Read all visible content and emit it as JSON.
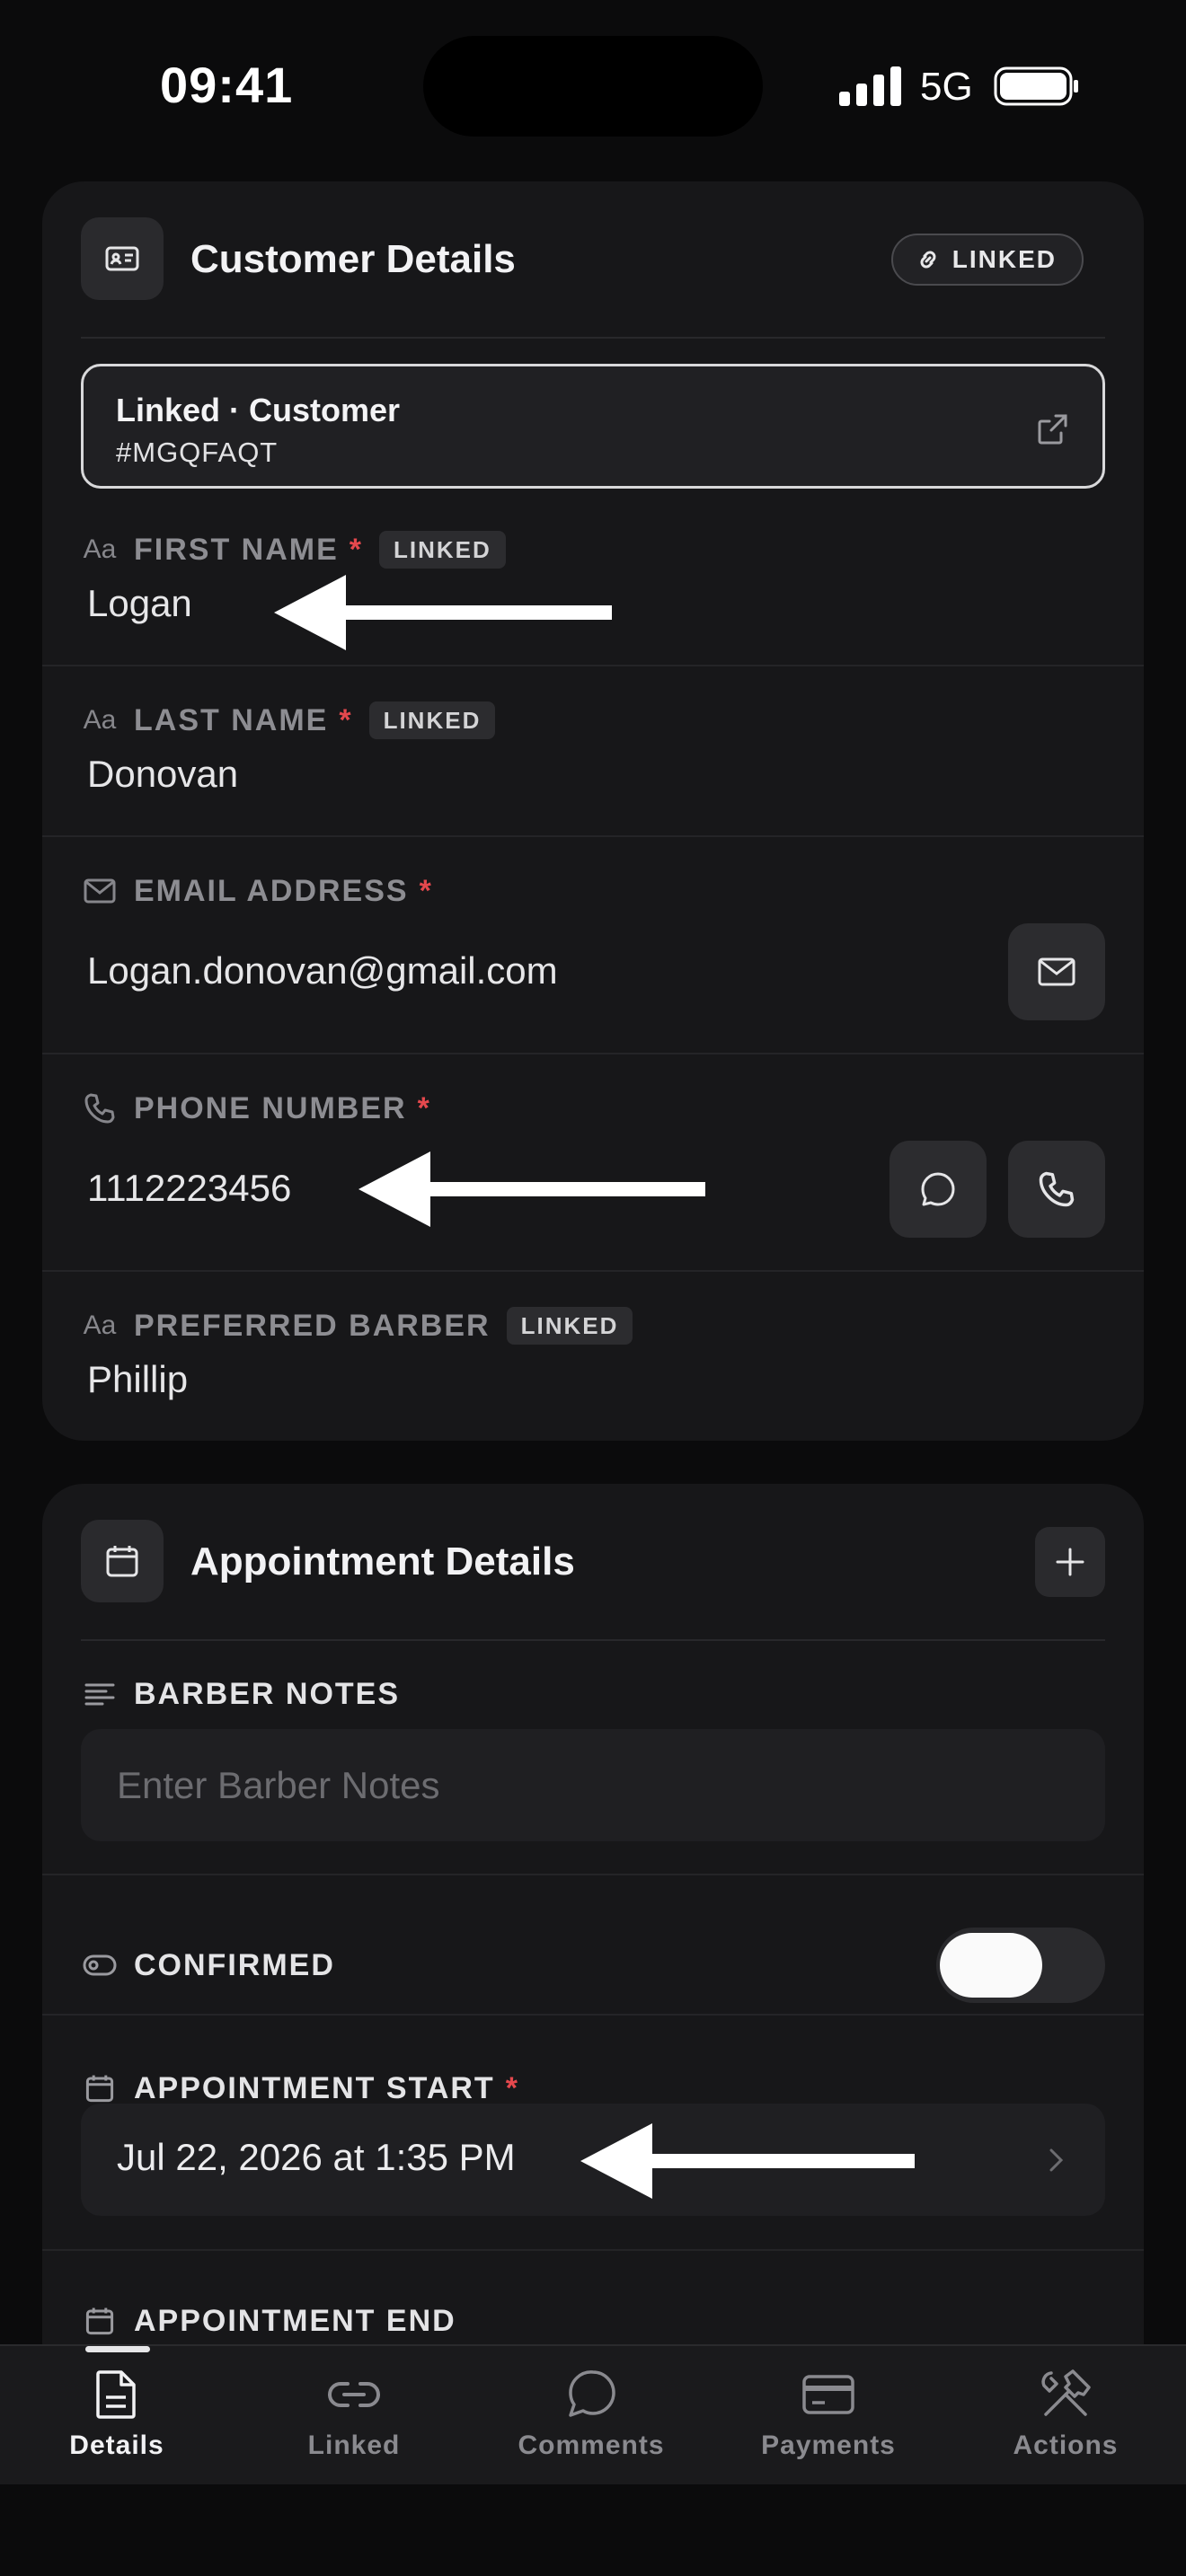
{
  "status_bar": {
    "time": "09:41",
    "network": "5G"
  },
  "customer_card": {
    "title": "Customer Details",
    "linked_pill": "LINKED",
    "linked_record": {
      "title": "Linked · Customer",
      "id": "#MGQFAQT"
    },
    "fields": {
      "first_name": {
        "label": "FIRST NAME",
        "required": "*",
        "tag": "LINKED",
        "value": "Logan"
      },
      "last_name": {
        "label": "LAST NAME",
        "required": "*",
        "tag": "LINKED",
        "value": "Donovan"
      },
      "email": {
        "label": "EMAIL ADDRESS",
        "required": "*",
        "value": "Logan.donovan@gmail.com"
      },
      "phone": {
        "label": "PHONE NUMBER",
        "required": "*",
        "value": "1112223456"
      },
      "barber": {
        "label": "PREFERRED BARBER",
        "tag": "LINKED",
        "value": "Phillip"
      }
    },
    "text_icon": "Aa"
  },
  "appointment_card": {
    "title": "Appointment Details",
    "barber_notes": {
      "label": "BARBER NOTES",
      "placeholder": "Enter Barber Notes"
    },
    "confirmed": {
      "label": "CONFIRMED",
      "on": true
    },
    "appointment_start": {
      "label": "APPOINTMENT START",
      "required": "*",
      "value": "Jul 22, 2026 at 1:35 PM"
    },
    "appointment_end": {
      "label": "APPOINTMENT END"
    }
  },
  "tabs": [
    {
      "label": "Details",
      "icon": "document-icon",
      "active": true
    },
    {
      "label": "Linked",
      "icon": "link-icon",
      "active": false
    },
    {
      "label": "Comments",
      "icon": "comment-icon",
      "active": false
    },
    {
      "label": "Payments",
      "icon": "card-icon",
      "active": false
    },
    {
      "label": "Actions",
      "icon": "tools-icon",
      "active": false
    }
  ],
  "colors": {
    "background": "#0b0b0c",
    "card": "#171719",
    "required": "#e5484d",
    "accent": "#ffffff"
  }
}
